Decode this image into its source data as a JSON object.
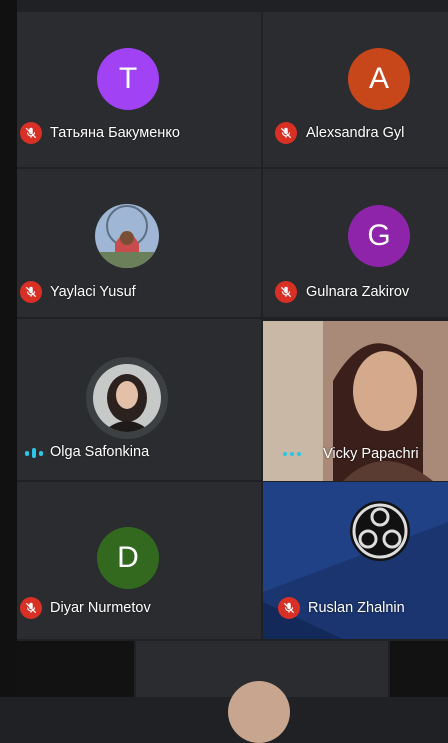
{
  "participants": [
    {
      "name": "Татьяна Бакуменко",
      "initial": "T",
      "color": "#a142f4",
      "muted": true
    },
    {
      "name": "Alexsandra Gyl",
      "initial": "A",
      "color": "#c8471a",
      "muted": true
    },
    {
      "name": "Yaylaci Yusuf",
      "initial": "",
      "muted": true
    },
    {
      "name": "Gulnara Zakirov",
      "initial": "G",
      "color": "#8e24aa",
      "muted": true
    },
    {
      "name": "Olga Safonkina",
      "initial": "",
      "muted": false
    },
    {
      "name": "Vicky Papachri",
      "initial": "",
      "muted": false
    },
    {
      "name": "Diyar Nurmetov",
      "initial": "D",
      "color": "#33691e",
      "muted": true
    },
    {
      "name": "Ruslan Zhalnin",
      "initial": "",
      "muted": true
    }
  ],
  "colors": {
    "mute_red": "#d93025",
    "speaking_cyan": "#29c7e6",
    "tile_bg": "#2b2c2f"
  }
}
